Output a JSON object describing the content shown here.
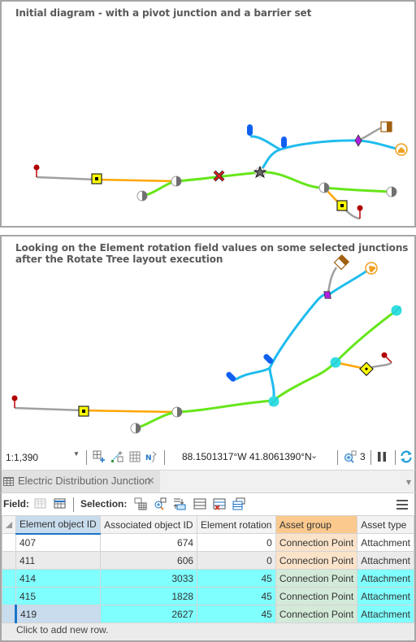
{
  "panel_top": {
    "caption": "Initial diagram - with a pivot junction and a barrier set"
  },
  "panel_bottom": {
    "caption_line1": "Looking on the Element rotation field values on some selected junctions",
    "caption_line2": "after the Rotate Tree layout execution"
  },
  "colors": {
    "line_green": "#66e61a",
    "line_blue": "#1fbcee",
    "line_orange": "#ffa500",
    "line_grey": "#a0a0a0",
    "selected_cyan": "#33dde0",
    "pin_red": "#b00000",
    "transformer_yellow": "#ffff00",
    "switch_purple": "#b020e0",
    "service_orange": "#f0a020",
    "meter_brown": "#a06010",
    "fuse_blue": "#1060f0"
  },
  "statusbar": {
    "scale": "1:1,390",
    "coordinates": "88.1501317°W 41.8061390°N",
    "selected_count": "3"
  },
  "table_tab": {
    "label": "Electric Distribution Junction"
  },
  "toolbar": {
    "field_label": "Field:",
    "selection_label": "Selection:"
  },
  "table": {
    "columns": [
      "Element object ID",
      "Associated object ID",
      "Element rotation",
      "Asset group",
      "Asset type"
    ],
    "rows": [
      {
        "element_id": "407",
        "associated_id": "674",
        "rotation": "0",
        "asset_group": "Connection Point",
        "asset_type": "Attachment"
      },
      {
        "element_id": "411",
        "associated_id": "606",
        "rotation": "0",
        "asset_group": "Connection Point",
        "asset_type": "Attachment"
      },
      {
        "element_id": "414",
        "associated_id": "3033",
        "rotation": "45",
        "asset_group": "Connection Point",
        "asset_type": "Attachment"
      },
      {
        "element_id": "415",
        "associated_id": "1828",
        "rotation": "45",
        "asset_group": "Connection Point",
        "asset_type": "Attachment"
      },
      {
        "element_id": "419",
        "associated_id": "2627",
        "rotation": "45",
        "asset_group": "Connection Point",
        "asset_type": "Attachment"
      }
    ],
    "add_row_text": "Click to add new row."
  }
}
